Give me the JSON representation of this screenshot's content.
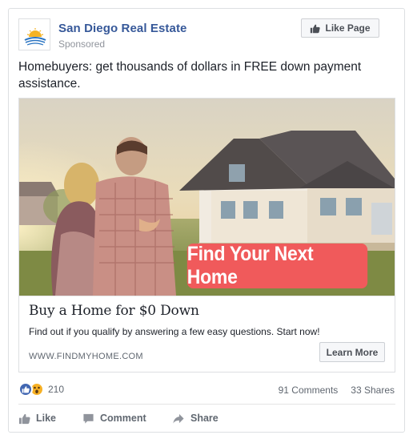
{
  "header": {
    "page_name": "San Diego Real Estate",
    "sponsored_label": "Sponsored",
    "like_page_label": "Like Page",
    "logo_icon": "sun-over-house-logo"
  },
  "post": {
    "text": "Homebuyers: get thousands of dollars in FREE down payment assistance."
  },
  "ad": {
    "image_banner_text": "Find Your Next Home",
    "headline": "Buy a Home for $0 Down",
    "description": "Find out if you qualify by answering a few easy questions. Start now!",
    "domain": "WWW.FINDMYHOME.COM",
    "cta_label": "Learn More"
  },
  "engagement": {
    "reaction_count": "210",
    "reaction_icons": [
      "like-reaction-icon",
      "wow-reaction-icon"
    ],
    "comments": "91 Comments",
    "shares": "33 Shares"
  },
  "actions": {
    "like": "Like",
    "comment": "Comment",
    "share": "Share"
  },
  "colors": {
    "brand_link": "#365899",
    "cta_banner": "#f05a5b",
    "like_blue": "#4267b2",
    "muted_text": "#90949c"
  }
}
